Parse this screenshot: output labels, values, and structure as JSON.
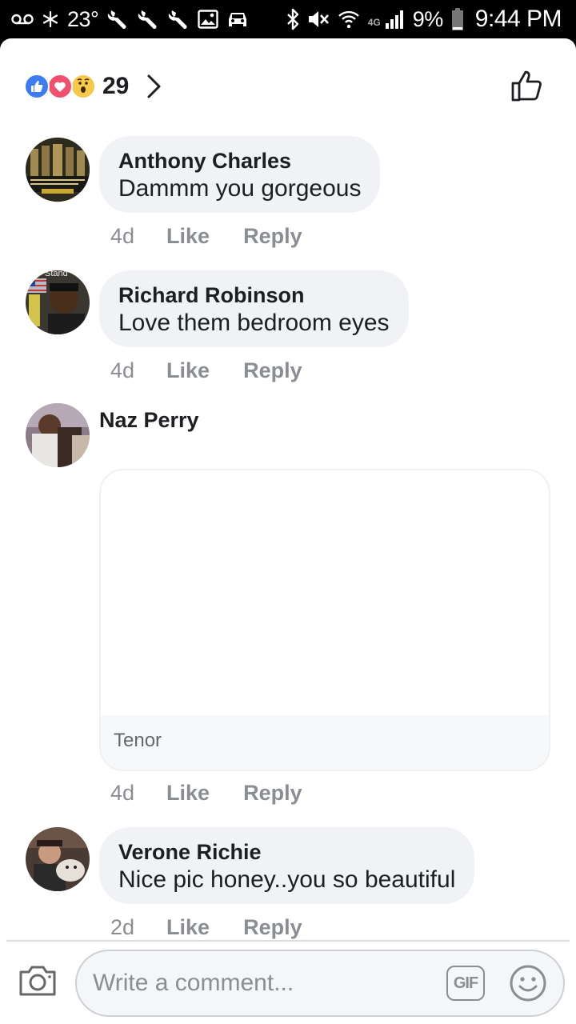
{
  "status_bar": {
    "temperature": "23°",
    "battery": "9%",
    "network": "4G",
    "time": "9:44 PM",
    "icons": [
      "voicemail-icon",
      "snowflake-icon",
      "wrench-icon",
      "wrench-icon",
      "wrench-icon",
      "image-icon",
      "car-icon",
      "bluetooth-icon",
      "mute-icon",
      "wifi-icon",
      "signal-icon",
      "battery-icon"
    ]
  },
  "reactions": {
    "types": [
      "like",
      "love",
      "wow"
    ],
    "count": "29",
    "colors": {
      "like": "#3b7cf3",
      "love": "#f0506e",
      "wow": "#f7c84a"
    }
  },
  "comments": [
    {
      "author": "Anthony Charles",
      "text": "Dammm you gorgeous",
      "time": "4d",
      "like_label": "Like",
      "reply_label": "Reply"
    },
    {
      "author": "Richard Robinson",
      "text": "Love them bedroom eyes",
      "time": "4d",
      "like_label": "Like",
      "reply_label": "Reply"
    },
    {
      "author": "Naz Perry",
      "gif_source": "Tenor",
      "time": "4d",
      "like_label": "Like",
      "reply_label": "Reply"
    },
    {
      "author": "Verone Richie",
      "text": "Nice pic honey..you so beautiful",
      "time": "2d",
      "like_label": "Like",
      "reply_label": "Reply"
    }
  ],
  "avatar_texts": {
    "richard": "Stand"
  },
  "composer": {
    "placeholder": "Write a comment...",
    "gif_label": "GIF"
  }
}
